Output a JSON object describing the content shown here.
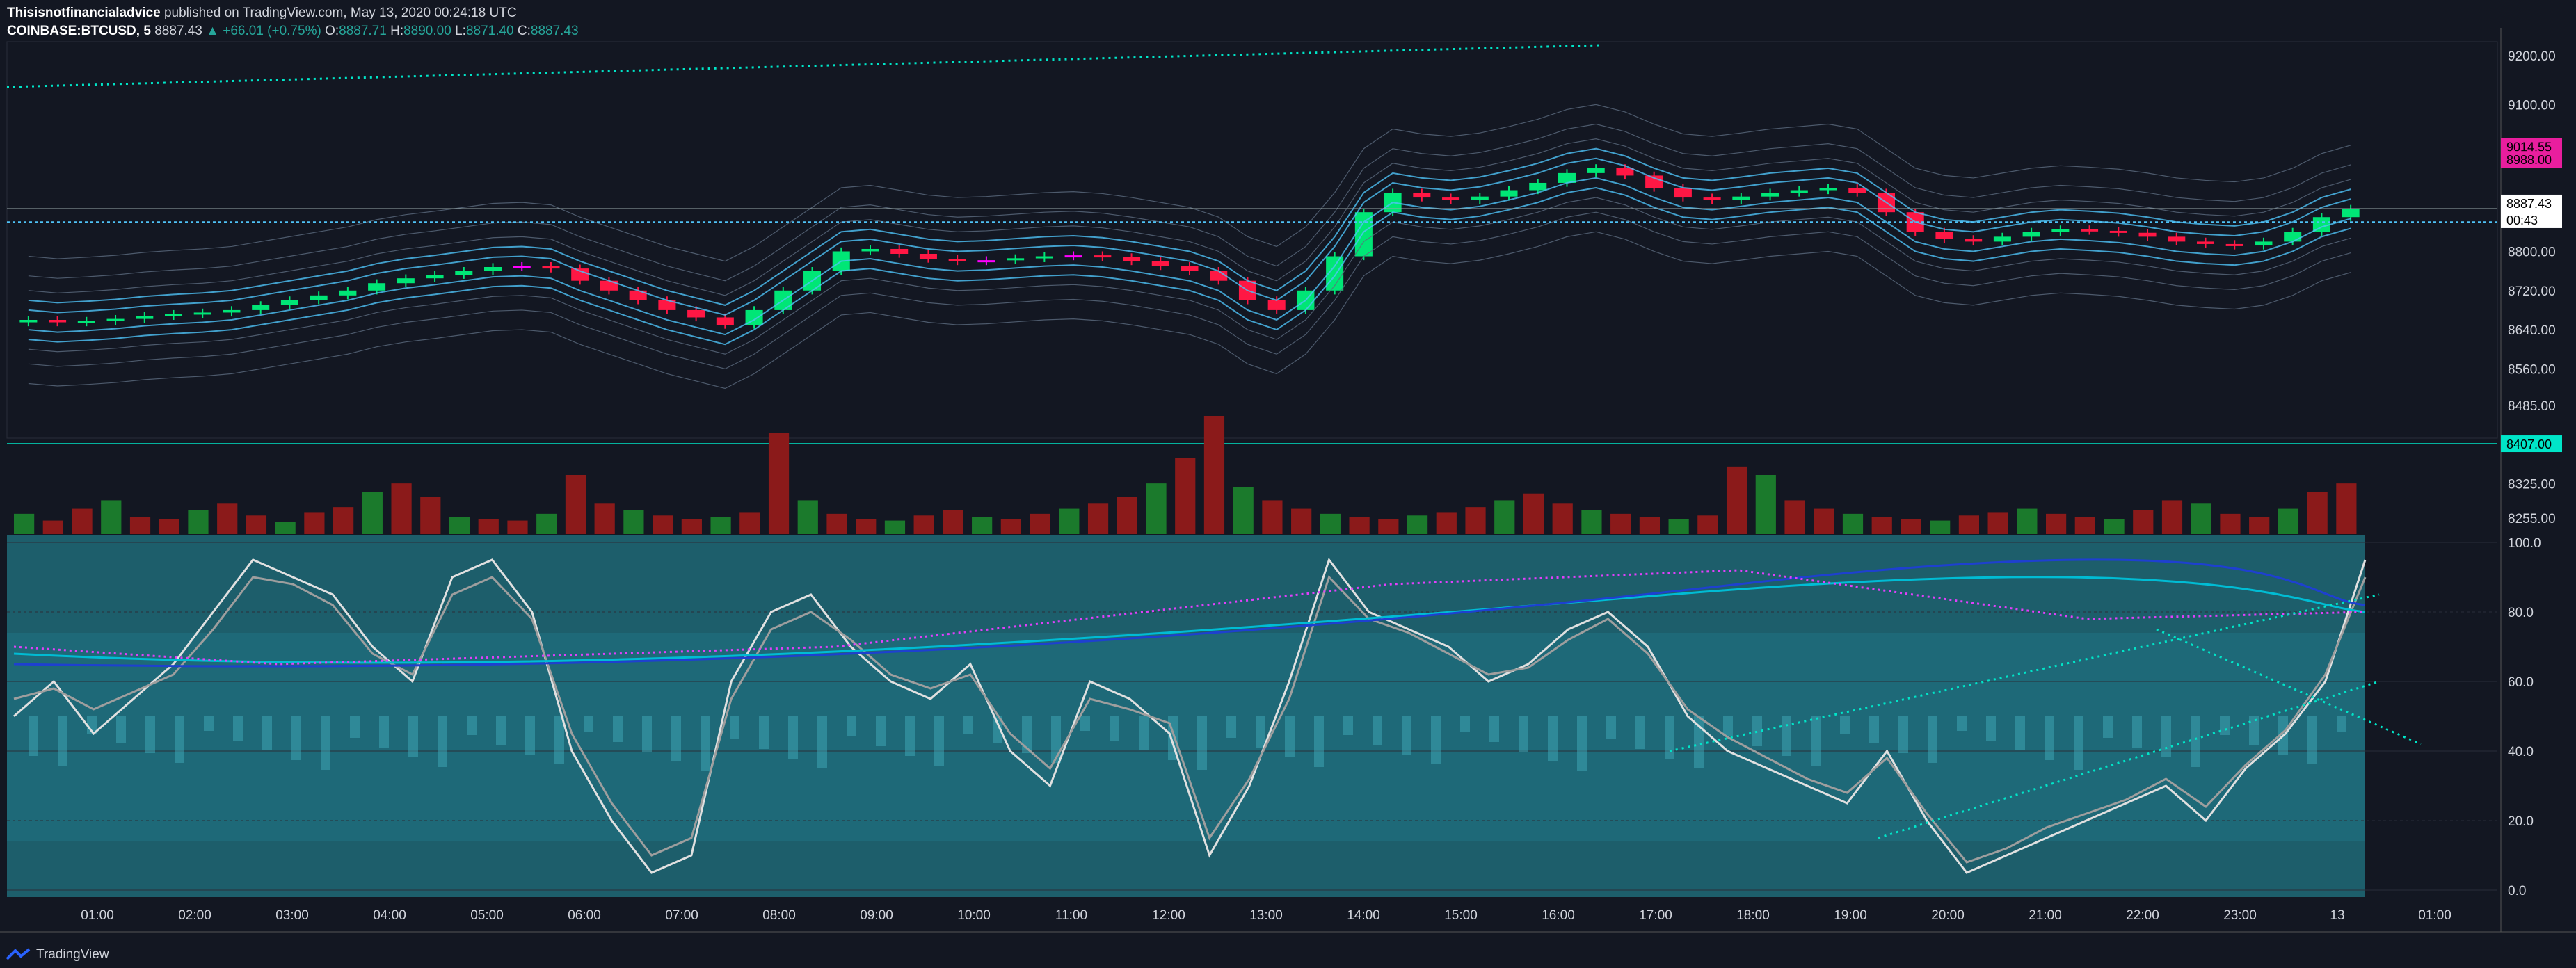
{
  "header": {
    "author": "Thisisnotfinancialadvice",
    "published": "published on TradingView.com, May 13, 2020 00:24:18 UTC",
    "symbol": "COINBASE:BTCUSD, 5",
    "last": "8887.43",
    "change": "▲ +66.01 (+0.75%)",
    "o_label": "O:",
    "o_val": "8887.71",
    "h_label": "H:",
    "h_val": "8890.00",
    "l_label": "L:",
    "l_val": "8871.40",
    "c_label": "C:",
    "c_val": "8887.43"
  },
  "footer": {
    "brand": "TradingView"
  },
  "colors": {
    "background": "#131722",
    "up": "#00e676",
    "down": "#ff1744",
    "doji": "#ff00ff",
    "band": "#2a9fd6",
    "volume_up": "#1b7a2c",
    "volume_down": "#8b1a1a",
    "osc_bg": "#1d5e6b",
    "cyan_line": "#00bcd4",
    "magenta_dot": "#e040fb"
  },
  "chart_data": [
    {
      "type": "candlestick",
      "title": "",
      "price_axis_ticks": [
        "9200.00",
        "9100.00",
        "8800.00",
        "8720.00",
        "8640.00",
        "8560.00",
        "8485.00",
        "8325.00",
        "8255.00"
      ],
      "price_tags": [
        {
          "text": "9014.55",
          "color": "#e91e9e"
        },
        {
          "text": "8988.00",
          "color": "#e91e9e"
        },
        {
          "text": "8887.43",
          "color": "#ffffff"
        },
        {
          "text": "00:43",
          "color": "#ffffff"
        },
        {
          "text": "8407.00",
          "color": "#00e5c8"
        }
      ],
      "ylim": [
        8255,
        9200
      ],
      "series": [
        {
          "name": "",
          "values": [
            8660,
            8655,
            8658,
            8662,
            8668,
            8672,
            8675,
            8680,
            8690,
            8700,
            8710,
            8720,
            8735,
            8745,
            8752,
            8760,
            8768,
            8770,
            8765,
            8740,
            8720,
            8700,
            8680,
            8665,
            8650,
            8680,
            8720,
            8760,
            8800,
            8805,
            8795,
            8785,
            8780,
            8782,
            8786,
            8790,
            8792,
            8788,
            8780,
            8770,
            8760,
            8740,
            8700,
            8680,
            8720,
            8790,
            8880,
            8920,
            8910,
            8905,
            8912,
            8925,
            8940,
            8960,
            8970,
            8955,
            8930,
            8910,
            8905,
            8912,
            8920,
            8925,
            8930,
            8920,
            8880,
            8840,
            8825,
            8820,
            8830,
            8840,
            8845,
            8842,
            8838,
            8830,
            8820,
            8815,
            8812,
            8820,
            8840,
            8870,
            8887
          ]
        }
      ]
    },
    {
      "type": "bar",
      "title": "",
      "series": [
        {
          "name": "",
          "values": [
            12,
            8,
            15,
            20,
            10,
            9,
            14,
            18,
            11,
            7,
            13,
            16,
            25,
            30,
            22,
            10,
            9,
            8,
            12,
            35,
            18,
            14,
            11,
            9,
            10,
            13,
            60,
            20,
            12,
            9,
            8,
            11,
            14,
            10,
            9,
            12,
            15,
            18,
            22,
            30,
            45,
            70,
            28,
            20,
            15,
            12,
            10,
            9,
            11,
            13,
            16,
            20,
            24,
            18,
            14,
            12,
            10,
            9,
            11,
            40,
            35,
            20,
            15,
            12,
            10,
            9,
            8,
            11,
            13,
            15,
            12,
            10,
            9,
            14,
            20,
            18,
            12,
            10,
            15,
            25,
            30
          ]
        }
      ]
    },
    {
      "type": "line",
      "title": "",
      "y_ticks": [
        "100.0",
        "80.0",
        "60.0",
        "40.0",
        "20.0",
        "0.0"
      ],
      "ylim": [
        0,
        100
      ],
      "x_ticks": [
        "01:00",
        "02:00",
        "03:00",
        "04:00",
        "05:00",
        "06:00",
        "07:00",
        "08:00",
        "09:00",
        "10:00",
        "11:00",
        "12:00",
        "13:00",
        "14:00",
        "15:00",
        "16:00",
        "17:00",
        "18:00",
        "19:00",
        "20:00",
        "21:00",
        "22:00",
        "23:00",
        "13",
        "01:00"
      ],
      "series": [
        {
          "name": "",
          "values": [
            50,
            60,
            45,
            55,
            65,
            80,
            95,
            90,
            85,
            70,
            60,
            90,
            95,
            80,
            40,
            20,
            5,
            10,
            60,
            80,
            85,
            70,
            60,
            55,
            65,
            40,
            30,
            60,
            55,
            45,
            10,
            30,
            60,
            95,
            80,
            75,
            70,
            60,
            65,
            75,
            80,
            70,
            50,
            40,
            35,
            30,
            25,
            40,
            20,
            5,
            10,
            15,
            20,
            25,
            30,
            20,
            35,
            45,
            60,
            95
          ]
        },
        {
          "name": "",
          "values": [
            55,
            58,
            52,
            57,
            62,
            75,
            90,
            88,
            82,
            68,
            62,
            85,
            90,
            78,
            45,
            25,
            10,
            15,
            55,
            75,
            80,
            72,
            62,
            58,
            62,
            45,
            35,
            55,
            52,
            48,
            15,
            32,
            55,
            90,
            78,
            74,
            68,
            62,
            64,
            72,
            78,
            68,
            52,
            44,
            38,
            32,
            28,
            38,
            22,
            8,
            12,
            18,
            22,
            26,
            32,
            24,
            36,
            46,
            62,
            90
          ]
        }
      ]
    }
  ]
}
